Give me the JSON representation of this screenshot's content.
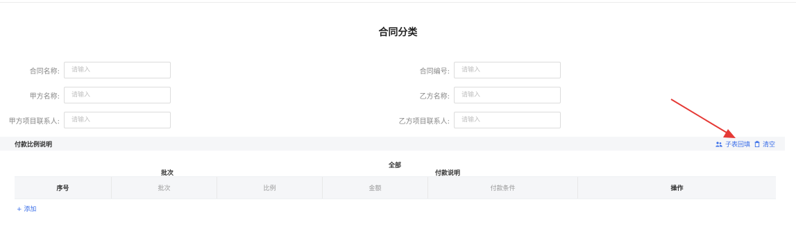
{
  "page_title": "合同分类",
  "form": {
    "fields": [
      {
        "label": "合同名称:",
        "placeholder": "请输入"
      },
      {
        "label": "合同编号:",
        "placeholder": "请输入"
      },
      {
        "label": "甲方名称:",
        "placeholder": "请输入"
      },
      {
        "label": "乙方名称:",
        "placeholder": "请输入"
      },
      {
        "label": "甲方项目联系人:",
        "placeholder": "请输入"
      },
      {
        "label": "乙方项目联系人:",
        "placeholder": "请输入"
      }
    ]
  },
  "section": {
    "title": "付款比例说明",
    "fill_sub_table_label": "子表回填",
    "clear_label": "清空"
  },
  "table": {
    "group_headers": {
      "all": "全部",
      "batch": "批次",
      "payment_note": "付款说明"
    },
    "columns": [
      "序号",
      "批次",
      "比例",
      "金额",
      "付款条件",
      "操作"
    ],
    "add_row_label": "+ 添加"
  },
  "colors": {
    "accent": "#3a6ee8",
    "annotation_arrow": "#e53935"
  },
  "icons": [
    "users-icon",
    "trash-icon",
    "annotation-arrow-icon"
  ]
}
